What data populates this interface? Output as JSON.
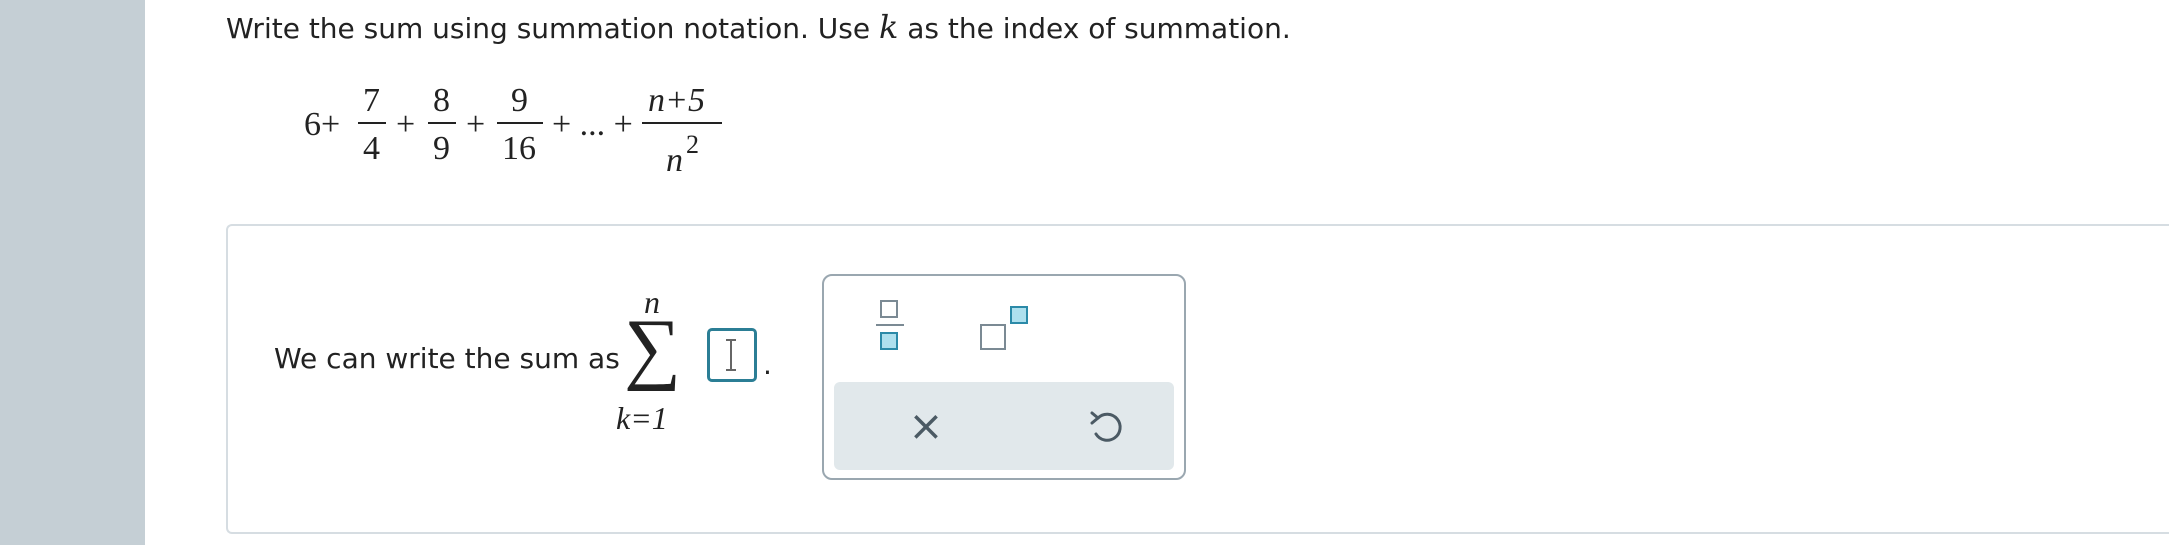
{
  "prompt": {
    "part1": "Write the sum using summation notation. Use ",
    "var": "k",
    "part2": " as the index of summation."
  },
  "expression": {
    "lead": "6+",
    "terms": [
      {
        "num": "7",
        "den": "4"
      },
      {
        "num": "8",
        "den": "9"
      },
      {
        "num": "9",
        "den": "16"
      }
    ],
    "plus": "+",
    "ellipsis": "+ ... +",
    "last": {
      "num": "n+5",
      "den_base": "n",
      "den_exp": "2"
    }
  },
  "answer": {
    "label": "We can write the sum as",
    "sigma": "∑",
    "upper": "n",
    "lower": "k=1",
    "value": "",
    "period": "."
  },
  "palette": {
    "fraction_icon": "fraction-icon",
    "power_icon": "exponent-icon",
    "clear_symbol": "×",
    "undo_icon": "undo-icon"
  },
  "colors": {
    "rail": "#c5cfd5",
    "accent": "#2b7e95",
    "action_bar": "#e1e8eb"
  }
}
